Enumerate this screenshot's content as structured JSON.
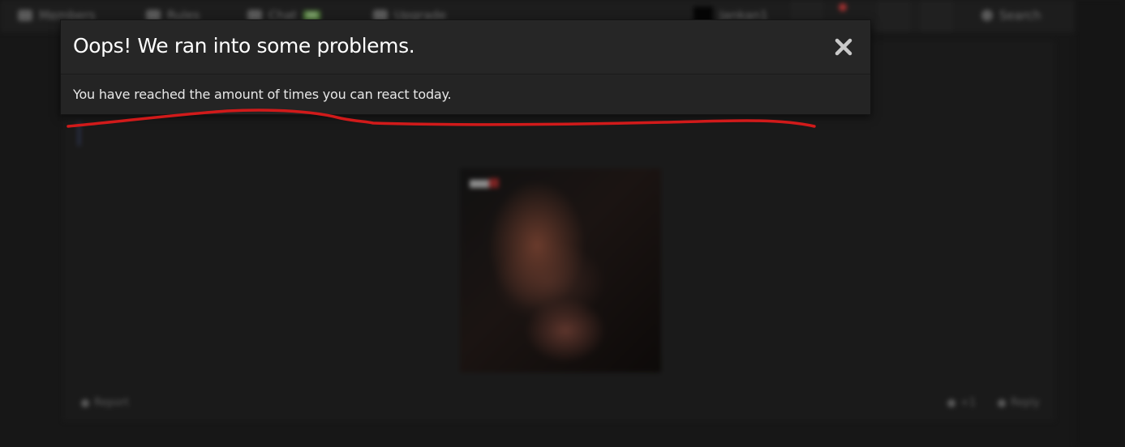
{
  "nav": {
    "members_label": "Members",
    "rules_label": "Rules",
    "chat_label": "Chat",
    "chat_badge": "99",
    "upgrade_label": "Upgrade",
    "username": "Jankan1",
    "search_label": "Search"
  },
  "dialog": {
    "title": "Oops! We ran into some problems.",
    "message": "You have reached the amount of times you can react today.",
    "close_icon": "close-icon"
  },
  "post": {
    "report_label": "Report",
    "like_count": "+1",
    "reply_label": "Reply"
  },
  "colors": {
    "annotation_stroke": "#d11a1a",
    "dialog_background": "#242424",
    "title_color": "#ffffff"
  }
}
